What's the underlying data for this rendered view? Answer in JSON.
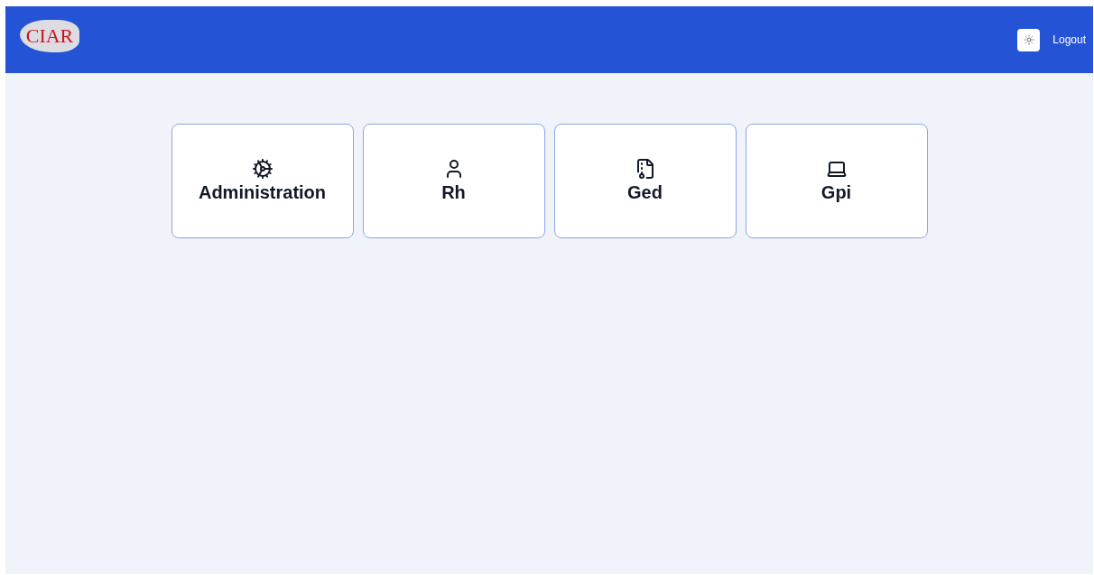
{
  "header": {
    "logo_text": "CIAR",
    "logout": "Logout"
  },
  "modules": [
    {
      "label": "Administration",
      "kind": "settings"
    },
    {
      "label": "Rh",
      "kind": "user"
    },
    {
      "label": "Ged",
      "kind": "file"
    },
    {
      "label": "Gpi",
      "kind": "laptop"
    }
  ]
}
